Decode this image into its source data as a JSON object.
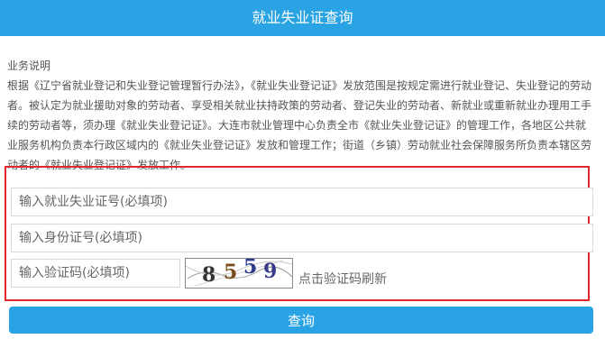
{
  "header": {
    "title": "就业失业证查询"
  },
  "description": {
    "title": "业务说明",
    "body": "根据《辽宁省就业登记和失业登记管理暂行办法》，《就业失业登记证》发放范围是按规定需进行就业登记、失业登记的劳动者。被认定为就业援助对象的劳动者、享受相关就业扶持政策的劳动者、登记失业的劳动者、新就业或重新就业办理用工手续的劳动者等，须办理《就业失业登记证》。大连市就业管理中心负责全市《就业失业登记证》的管理工作，各地区公共就业服务机构负责本行政区域内的《就业失业登记证》发放和管理工作；街道（乡镇）劳动就业社会保障服务所负责本辖区劳动者的《就业失业登记证》发放工作。"
  },
  "form": {
    "cert_placeholder": "输入就业失业证号(必填项)",
    "id_placeholder": "输入身份证号(必填项)",
    "captcha_placeholder": "输入验证码(必填项)",
    "captcha_text": "8559",
    "refresh_hint": "点击验证码刷新",
    "submit_label": "查询"
  },
  "colors": {
    "brand": "#29a3e4",
    "highlight_border": "#e0282e"
  }
}
